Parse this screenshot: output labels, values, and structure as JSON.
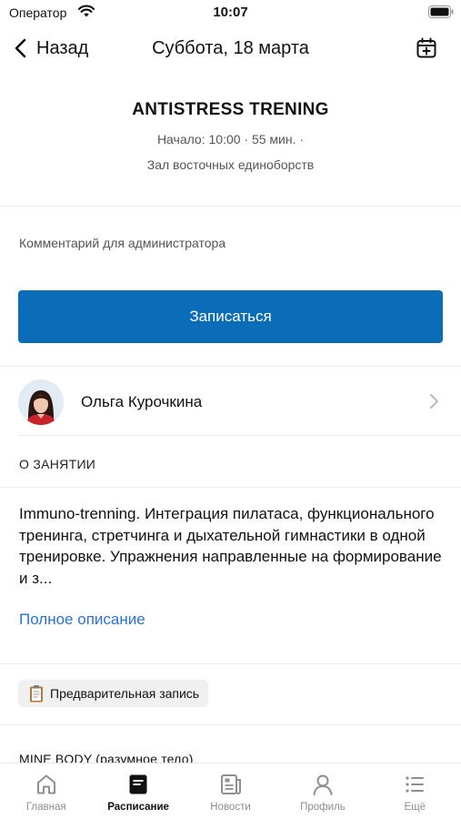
{
  "status_bar": {
    "carrier": "Оператор",
    "time": "10:07"
  },
  "nav": {
    "back_label": "Назад",
    "title": "Суббота, 18 марта"
  },
  "event": {
    "title": "ANTISTRESS TRENING",
    "meta": "Начало: 10:00  ·  55 мин.  ·",
    "room": "Зал восточных единоборств"
  },
  "comment": {
    "placeholder": "Комментарий для администратора"
  },
  "signup_button": "Записаться",
  "trainer": {
    "name": "Ольга Курочкина"
  },
  "about": {
    "heading": "О ЗАНЯТИИ",
    "description": "Immuno-trenning. Интеграция пилатаса, функционального тренинга, стретчинга и дыхательной гимнастики в одной тренировке. Упражнения направленные на формирование и з...",
    "full_link": "Полное описание"
  },
  "badge": {
    "label": "Предварительная запись"
  },
  "next_section_label": "MINE BODY (разумное тело)",
  "colors": {
    "accent": "#0b6db8",
    "link": "#2b72d6"
  },
  "tab_bar": {
    "tabs": [
      {
        "label": "Главная",
        "icon": "home-icon",
        "active": false
      },
      {
        "label": "Расписание",
        "icon": "schedule-icon",
        "active": true
      },
      {
        "label": "Новости",
        "icon": "news-icon",
        "active": false
      },
      {
        "label": "Профиль",
        "icon": "profile-icon",
        "active": false
      },
      {
        "label": "Ещё",
        "icon": "more-list-icon",
        "active": false
      }
    ]
  }
}
